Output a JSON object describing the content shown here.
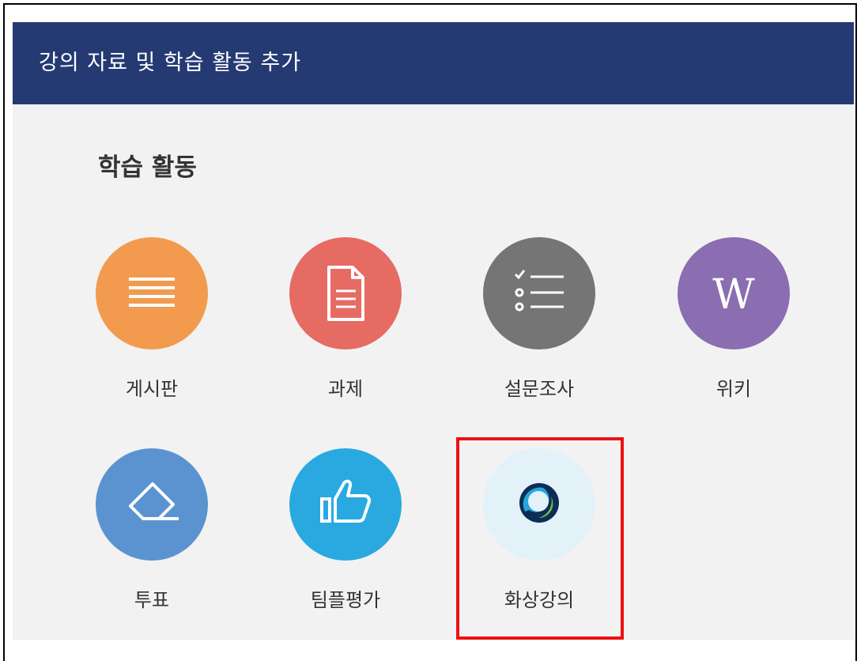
{
  "header": {
    "title": "강의 자료 및 학습 활동 추가",
    "bg_color": "#253a73"
  },
  "section": {
    "title": "학습 활동"
  },
  "activities": [
    {
      "label": "게시판",
      "icon": "lines-icon",
      "color": "#f29b4f"
    },
    {
      "label": "과제",
      "icon": "document-icon",
      "color": "#e56b63"
    },
    {
      "label": "설문조사",
      "icon": "checklist-icon",
      "color": "#757575"
    },
    {
      "label": "위키",
      "icon": "wiki-w-icon",
      "color": "#8b6db2",
      "icon_text": "W"
    },
    {
      "label": "투표",
      "icon": "eraser-icon",
      "color": "#5b93d0"
    },
    {
      "label": "팀플평가",
      "icon": "thumbs-up-icon",
      "color": "#2aa9e0"
    },
    {
      "label": "화상강의",
      "icon": "webex-icon",
      "color": "#e3f1f8",
      "selected": true
    }
  ],
  "highlight_color": "#ee1111"
}
